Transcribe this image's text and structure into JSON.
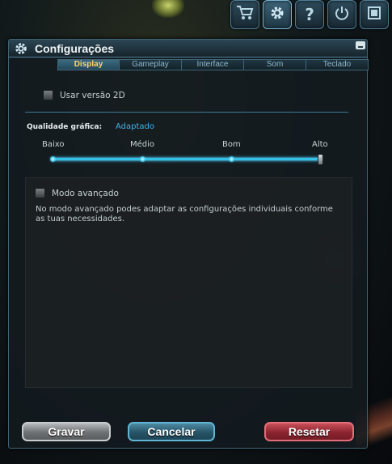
{
  "topbar": {
    "buttons": [
      {
        "icon": "shopping-cart-icon",
        "glyph": "🛒"
      },
      {
        "icon": "gear-icon",
        "glyph": "⚙"
      },
      {
        "icon": "help-icon",
        "glyph": "?"
      },
      {
        "icon": "power-icon",
        "glyph": "⏻"
      },
      {
        "icon": "fullscreen-icon",
        "glyph": "▣"
      }
    ]
  },
  "panel": {
    "title": "Configurações",
    "tabs": [
      "Display",
      "Gameplay",
      "Interface",
      "Som",
      "Teclado"
    ],
    "active_tab": "Display"
  },
  "display": {
    "use_2d_label": "Usar versão 2D",
    "use_2d_checked": false,
    "quality_label": "Qualidade gráfica:",
    "quality_value": "Adaptado",
    "quality_levels": [
      "Baixo",
      "Médio",
      "Bom",
      "Alto"
    ],
    "quality_selected": "Alto",
    "advanced_label": "Modo avançado",
    "advanced_checked": false,
    "advanced_description": "No modo avançado podes adaptar as configurações individuais conforme as tuas necessidades."
  },
  "buttons": {
    "save": "Gravar",
    "cancel": "Cancelar",
    "reset": "Resetar"
  },
  "colors": {
    "accent": "#3fb3ea",
    "active_tab_text": "#ffd56a",
    "reset": "#8c2530"
  }
}
